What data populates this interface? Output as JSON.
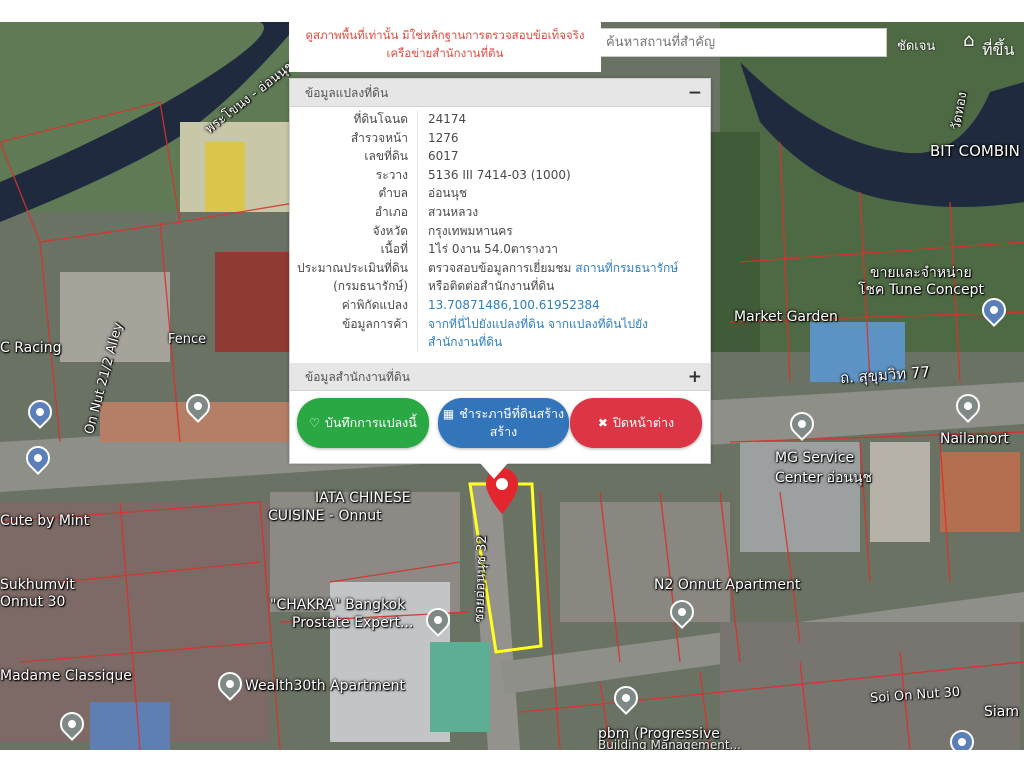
{
  "disclaimer": {
    "line1": "ดูสภาพพื้นที่เท่านั้น มิใช่หลักฐานการตรวจสอบข้อเท็จจริง",
    "line2": "เครือข่ายสำนักงานที่ดิน"
  },
  "search": {
    "placeholder": "ค้นหาสถานที่สำคัญ"
  },
  "top_right": {
    "zoom_label": "ชัดเจน",
    "cut_label": "ที่ขึ้น"
  },
  "panel": {
    "section_title": "ข้อมูลแปลงที่ดิน",
    "collapse_symbol": "−",
    "fields": [
      {
        "k": "ที่ดินโฉนด",
        "v": "24174"
      },
      {
        "k": "สำรวจหน้า",
        "v": "1276"
      },
      {
        "k": "เลขที่ดิน",
        "v": "6017"
      },
      {
        "k": "ระวาง",
        "v": "5136 III 7414-03 (1000)"
      },
      {
        "k": "ตำบล",
        "v": "อ่อนนุช"
      },
      {
        "k": "อำเภอ",
        "v": "สวนหลวง"
      },
      {
        "k": "จังหวัด",
        "v": "กรุงเทพมหานคร"
      },
      {
        "k": "เนื้อที่",
        "v": "1ไร่ 0งาน 54.0ตารางวา"
      }
    ],
    "appraisal": {
      "k1": "ประมาณประเมินที่ดิน",
      "k2": "(กรมธนารักษ์)",
      "v1": "ตรวจสอบข้อมูลการเยี่ยมชม",
      "v1_link": "สถานที่กรมธนารักษ์",
      "v2": "หรือติดต่อสำนักงานที่ดิน"
    },
    "coords": {
      "k": "ค่าพิกัดแปลง",
      "v": "13.70871486,100.61952384"
    },
    "directions": {
      "k": "ข้อมูลการค้า",
      "v1": "จากที่นี่ไปยังแปลงที่ดิน จากแปลงที่ดินไปยัง",
      "v2": "สำนักงานที่ดิน"
    },
    "office_title": "ข้อมูลสำนักงานที่ดิน",
    "expand_symbol": "+"
  },
  "buttons": {
    "save": "บันทึกการแปลงนี้",
    "announce_1": "ชำระภาษีที่ดินสร้าง",
    "announce_2": "สร้าง",
    "close": "ปิดหน้าต่าง"
  },
  "map_labels": [
    "C Racing",
    "Fence",
    "On Nut 21/2 Alley",
    "BIT COMBIN",
    "Market Garden",
    "ถ. สุขุมวิท 77",
    "Nailamort",
    "MG Service",
    "Center อ่อนนุช",
    "IATA CHINESE",
    "CUISINE - Onnut",
    "Cute by Mint",
    "Sukhumvit",
    "Onnut 30",
    "\"CHAKRA\" Bangkok",
    "Prostate Expert...",
    "N2 Onnut Apartment",
    "Madame Classique",
    "Wealth30th Apartment",
    "Soi On Nut 30",
    "pbm (Progressive",
    "Building Management...",
    "Siam",
    "ขายและจำหน่าย",
    "โชค Tune Concept",
    "พระโขนง - อ่อนนุช",
    "วัดทอง",
    "ซอยอ่อนนุช 32"
  ]
}
